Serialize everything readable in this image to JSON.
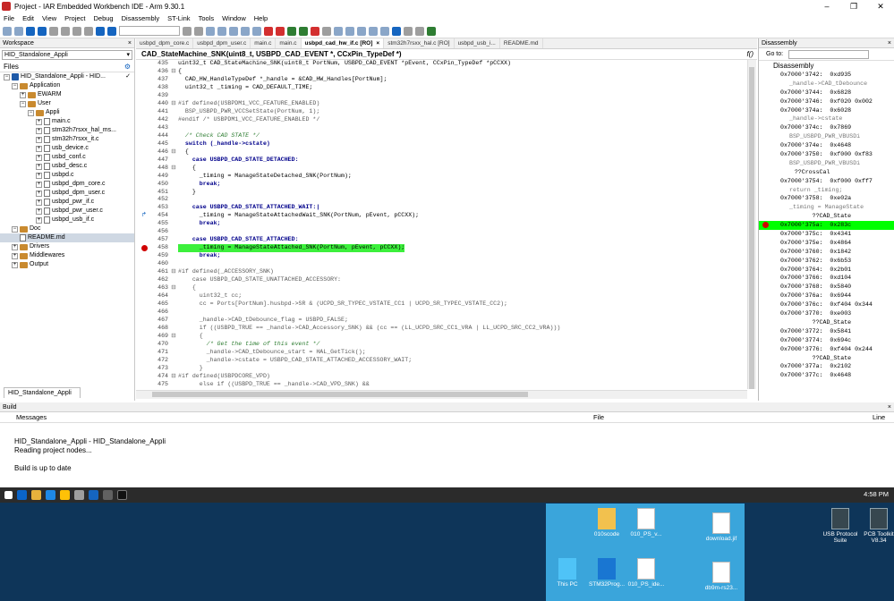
{
  "window": {
    "title": "Project - IAR Embedded Workbench IDE - Arm 9.30.1",
    "minimize": "–",
    "maximize": "❐",
    "close": "✕"
  },
  "menu": [
    "File",
    "Edit",
    "View",
    "Project",
    "Debug",
    "Disassembly",
    "ST-Link",
    "Tools",
    "Window",
    "Help"
  ],
  "workspace": {
    "title": "Workspace",
    "selector": "HID_Standalone_Appli",
    "files_label": "Files",
    "tab": "HID_Standalone_Appli",
    "tree": [
      {
        "label": "HID_Standalone_Appli - HID...",
        "type": "proj",
        "depth": 0,
        "exp": "−",
        "check": "✓"
      },
      {
        "label": "Application",
        "type": "folder",
        "depth": 1,
        "exp": "−"
      },
      {
        "label": "EWARM",
        "type": "folder",
        "depth": 2,
        "exp": "+"
      },
      {
        "label": "User",
        "type": "folder",
        "depth": 2,
        "exp": "−"
      },
      {
        "label": "Appli",
        "type": "folder",
        "depth": 3,
        "exp": "−"
      },
      {
        "label": "main.c",
        "type": "file",
        "depth": 4,
        "exp": "+"
      },
      {
        "label": "stm32h7rsxx_hal_ms...",
        "type": "file",
        "depth": 4,
        "exp": "+"
      },
      {
        "label": "stm32h7rsxx_it.c",
        "type": "file",
        "depth": 4,
        "exp": "+"
      },
      {
        "label": "usb_device.c",
        "type": "file",
        "depth": 4,
        "exp": "+"
      },
      {
        "label": "usbd_conf.c",
        "type": "file",
        "depth": 4,
        "exp": "+"
      },
      {
        "label": "usbd_desc.c",
        "type": "file",
        "depth": 4,
        "exp": "+"
      },
      {
        "label": "usbpd.c",
        "type": "file",
        "depth": 4,
        "exp": "+"
      },
      {
        "label": "usbpd_dpm_core.c",
        "type": "file",
        "depth": 4,
        "exp": "+"
      },
      {
        "label": "usbpd_dpm_user.c",
        "type": "file",
        "depth": 4,
        "exp": "+"
      },
      {
        "label": "usbpd_pwr_if.c",
        "type": "file",
        "depth": 4,
        "exp": "+"
      },
      {
        "label": "usbpd_pwr_user.c",
        "type": "file",
        "depth": 4,
        "exp": "+"
      },
      {
        "label": "usbpd_usb_if.c",
        "type": "file",
        "depth": 4,
        "exp": "+"
      },
      {
        "label": "Doc",
        "type": "folder",
        "depth": 1,
        "exp": "−"
      },
      {
        "label": "README.md",
        "type": "file",
        "depth": 2,
        "exp": "",
        "selected": true
      },
      {
        "label": "Drivers",
        "type": "folder",
        "depth": 1,
        "exp": "+"
      },
      {
        "label": "Middlewares",
        "type": "folder",
        "depth": 1,
        "exp": "+"
      },
      {
        "label": "Output",
        "type": "folder",
        "depth": 1,
        "exp": "+"
      }
    ]
  },
  "editor": {
    "tabs": [
      "usbpd_dpm_core.c",
      "usbpd_dpm_user.c",
      "main.c",
      "main.c",
      "usbpd_cad_hw_if.c [RO]",
      "stm32h7rsxx_hal.c [RO]",
      "usbpd_usb_i...",
      "README.md"
    ],
    "active_tab": 4,
    "tab_close": "×",
    "function_bar": "CAD_StateMachine_SNK(uint8_t, USBPD_CAD_EVENT *, CCxPin_TypeDef *)",
    "function_button": "f()",
    "lines": [
      {
        "n": "435",
        "f": "",
        "t": "uint32_t CAD_StateMachine_SNK(uint8_t PortNum, USBPD_CAD_EVENT *pEvent, CCxPin_TypeDef *pCCXX)",
        "c": ""
      },
      {
        "n": "436",
        "f": "⊟",
        "t": "{",
        "c": ""
      },
      {
        "n": "437",
        "f": "",
        "t": "  CAD_HW_HandleTypeDef *_handle = &CAD_HW_Handles[PortNum];",
        "c": ""
      },
      {
        "n": "438",
        "f": "",
        "t": "  uint32_t _timing = CAD_DEFAULT_TIME;",
        "c": ""
      },
      {
        "n": "439",
        "f": "",
        "t": "",
        "c": ""
      },
      {
        "n": "440",
        "f": "⊟",
        "t": "#if defined(USBPDM1_VCC_FEATURE_ENABLED)",
        "c": "pp"
      },
      {
        "n": "441",
        "f": "",
        "t": "  BSP_USBPD_PWR_VCCSetState(PortNum, 1);",
        "c": "pp"
      },
      {
        "n": "442",
        "f": "",
        "t": "#endif /* USBPDM1_VCC_FEATURE_ENABLED */",
        "c": "pp"
      },
      {
        "n": "443",
        "f": "",
        "t": "",
        "c": ""
      },
      {
        "n": "444",
        "f": "",
        "t": "  /* Check CAD STATE */",
        "c": "cm"
      },
      {
        "n": "445",
        "f": "",
        "t": "  switch (_handle->cstate)",
        "c": "kw"
      },
      {
        "n": "446",
        "f": "⊟",
        "t": "  {",
        "c": ""
      },
      {
        "n": "447",
        "f": "",
        "t": "    case USBPD_CAD_STATE_DETACHED:",
        "c": "kw"
      },
      {
        "n": "448",
        "f": "⊟",
        "t": "    {",
        "c": ""
      },
      {
        "n": "449",
        "f": "",
        "t": "      _timing = ManageStateDetached_SNK(PortNum);",
        "c": ""
      },
      {
        "n": "450",
        "f": "",
        "t": "      break;",
        "c": "kw"
      },
      {
        "n": "451",
        "f": "",
        "t": "    }",
        "c": ""
      },
      {
        "n": "452",
        "f": "",
        "t": "",
        "c": ""
      },
      {
        "n": "453",
        "f": "",
        "t": "    case USBPD_CAD_STATE_ATTACHED_WAIT:|",
        "c": "kw"
      },
      {
        "n": "454",
        "f": "",
        "t": "      _timing = ManageStateAttachedWait_SNK(PortNum, pEvent, pCCXX);",
        "c": "",
        "mark": "arrow"
      },
      {
        "n": "455",
        "f": "",
        "t": "      break;",
        "c": "kw"
      },
      {
        "n": "456",
        "f": "",
        "t": "",
        "c": ""
      },
      {
        "n": "457",
        "f": "",
        "t": "    case USBPD_CAD_STATE_ATTACHED:",
        "c": "kw"
      },
      {
        "n": "458",
        "f": "",
        "t": "      _timing = ManageStateAttached_SNK(PortNum, pEvent, pCCXX);",
        "c": "hl",
        "mark": "bp"
      },
      {
        "n": "459",
        "f": "",
        "t": "      break;",
        "c": "kw"
      },
      {
        "n": "460",
        "f": "",
        "t": "",
        "c": ""
      },
      {
        "n": "461",
        "f": "⊟",
        "t": "#if defined(_ACCESSORY_SNK)",
        "c": "pp"
      },
      {
        "n": "462",
        "f": "",
        "t": "    case USBPD_CAD_STATE_UNATTACHED_ACCESSORY:",
        "c": "pp"
      },
      {
        "n": "463",
        "f": "⊟",
        "t": "    {",
        "c": "pp"
      },
      {
        "n": "464",
        "f": "",
        "t": "      uint32_t cc;",
        "c": "pp"
      },
      {
        "n": "465",
        "f": "",
        "t": "      cc = Ports[PortNum].husbpd->SR & (UCPD_SR_TYPEC_VSTATE_CC1 | UCPD_SR_TYPEC_VSTATE_CC2);",
        "c": "pp"
      },
      {
        "n": "466",
        "f": "",
        "t": "",
        "c": ""
      },
      {
        "n": "467",
        "f": "",
        "t": "      _handle->CAD_tDebounce_flag = USBPD_FALSE;",
        "c": "pp"
      },
      {
        "n": "468",
        "f": "",
        "t": "      if ((USBPD_TRUE == _handle->CAD_Accessory_SNK) && (cc == (LL_UCPD_SRC_CC1_VRA | LL_UCPD_SRC_CC2_VRA)))",
        "c": "pp"
      },
      {
        "n": "469",
        "f": "⊟",
        "t": "      {",
        "c": "pp"
      },
      {
        "n": "470",
        "f": "",
        "t": "        /* Get the time of this event */",
        "c": "cm"
      },
      {
        "n": "471",
        "f": "",
        "t": "        _handle->CAD_tDebounce_start = HAL_GetTick();",
        "c": "pp"
      },
      {
        "n": "472",
        "f": "",
        "t": "        _handle->cstate = USBPD_CAD_STATE_ATTACHED_ACCESSORY_WAIT;",
        "c": "pp"
      },
      {
        "n": "473",
        "f": "",
        "t": "      }",
        "c": "pp"
      },
      {
        "n": "474",
        "f": "⊟",
        "t": "#if defined(USBPDCORE_VPD)",
        "c": "pp"
      },
      {
        "n": "475",
        "f": "",
        "t": "      else if ((USBPD_TRUE == _handle->CAD_VPD_SNK) &&",
        "c": "pp"
      },
      {
        "n": "476",
        "f": "",
        "t": "               ((cc == (LL_UCPD_SRC_CC1_VRD | LL_UCPD_SRC_CC2_VRA)",
        "c": "pp"
      }
    ]
  },
  "disassembly": {
    "title": "Disassembly",
    "goto_label": "Go to:",
    "label": "Disassembly",
    "lines": [
      {
        "t": "0x7000'3742:  0xd935",
        "k": ""
      },
      {
        "t": "_handle->CAD_tDebounce",
        "k": "src"
      },
      {
        "t": "0x7000'3744:  0x6828",
        "k": ""
      },
      {
        "t": "0x7000'3746:  0xf020 0x002",
        "k": ""
      },
      {
        "t": "0x7000'374a:  0x6028",
        "k": ""
      },
      {
        "t": "_handle->cstate",
        "k": "src"
      },
      {
        "t": "0x7000'374c:  0x7869",
        "k": ""
      },
      {
        "t": "BSP_USBPD_PWR_VBUSDi",
        "k": "src"
      },
      {
        "t": "0x7000'374e:  0x4648",
        "k": ""
      },
      {
        "t": "0x7000'3750:  0xf000 0xf83",
        "k": ""
      },
      {
        "t": "BSP_USBPD_PWR_VBUSDi",
        "k": "src"
      },
      {
        "t": "    ??CrossCal",
        "k": ""
      },
      {
        "t": "0x7000'3754:  0xf000 0xff7",
        "k": ""
      },
      {
        "t": "return _timing;",
        "k": "src"
      },
      {
        "t": "0x7000'3758:  0xe02a",
        "k": ""
      },
      {
        "t": "_timing = ManageState",
        "k": "src"
      },
      {
        "t": "         ??CAD_State",
        "k": ""
      },
      {
        "t": "0x7000'375a:  0x283c",
        "k": "cur"
      },
      {
        "t": "0x7000'375c:  0x4341",
        "k": ""
      },
      {
        "t": "0x7000'375e:  0x4864",
        "k": ""
      },
      {
        "t": "0x7000'3760:  0x1842",
        "k": ""
      },
      {
        "t": "0x7000'3762:  0x6b53",
        "k": ""
      },
      {
        "t": "0x7000'3764:  0x2b01",
        "k": ""
      },
      {
        "t": "0x7000'3766:  0xd104",
        "k": ""
      },
      {
        "t": "0x7000'3768:  0x5840",
        "k": ""
      },
      {
        "t": "0x7000'376a:  0x6944",
        "k": ""
      },
      {
        "t": "0x7000'376c:  0xf404 0x344",
        "k": ""
      },
      {
        "t": "0x7000'3770:  0xe003",
        "k": ""
      },
      {
        "t": "         ??CAD_State",
        "k": ""
      },
      {
        "t": "0x7000'3772:  0x5841",
        "k": ""
      },
      {
        "t": "0x7000'3774:  0x694c",
        "k": ""
      },
      {
        "t": "0x7000'3776:  0xf404 0x244",
        "k": ""
      },
      {
        "t": "         ??CAD_State",
        "k": ""
      },
      {
        "t": "0x7000'377a:  0x2102",
        "k": ""
      },
      {
        "t": "0x7000'377c:  0x4648",
        "k": ""
      }
    ]
  },
  "build": {
    "title": "Build",
    "col_messages": "Messages",
    "col_file": "File",
    "col_line": "Line",
    "messages": [
      "HID_Standalone_Appli - HID_Standalone_Appli",
      "Reading project nodes...",
      "",
      "Build is up to date"
    ]
  },
  "taskbar": {
    "time": "4:58 PM"
  },
  "desktop": {
    "icons": [
      {
        "label": "010scode",
        "kind": "folder"
      },
      {
        "label": "010_PS_v...",
        "kind": "doc"
      },
      {
        "label": "download.jif",
        "kind": "doc"
      },
      {
        "label": "USB Protocol Suite",
        "kind": "app"
      },
      {
        "label": "PCB Toolkit V8.34",
        "kind": "app"
      },
      {
        "label": "This PC",
        "kind": "pc"
      },
      {
        "label": "STM32Prog...",
        "kind": "prg"
      },
      {
        "label": "010_PS_ide...",
        "kind": "doc"
      },
      {
        "label": "db9m-rs23...",
        "kind": "doc"
      }
    ]
  },
  "colors": {
    "highlight": "#3cf03c",
    "breakpoint": "#d00000",
    "keyword": "#00008b",
    "comment": "#2e7d32",
    "desktop": "#0e3559"
  }
}
